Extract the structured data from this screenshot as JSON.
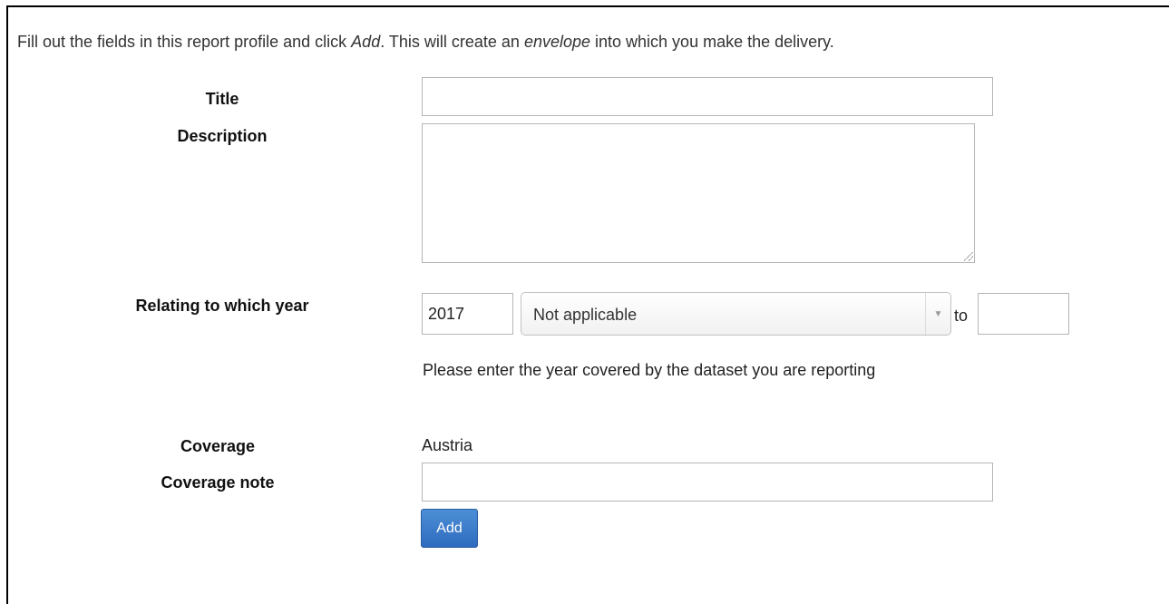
{
  "intro": {
    "part1": "Fill out the fields in this report profile and click ",
    "add_word": "Add",
    "part2": ". This will create an ",
    "envelope_word": "envelope",
    "part3": " into which you make the delivery."
  },
  "form": {
    "title_label": "Title",
    "title_value": "",
    "description_label": "Description",
    "description_value": "",
    "year_label": "Relating to which year",
    "year_value": "2017",
    "year_qualifier_selected": "Not applicable",
    "to_label": "to",
    "year_to_value": "",
    "year_help": "Please enter the year covered by the dataset you are reporting",
    "coverage_label": "Coverage",
    "coverage_value": "Austria",
    "coverage_note_label": "Coverage note",
    "coverage_note_value": "",
    "add_button": "Add"
  },
  "icons": {
    "select_arrow": "chevron-down-icon",
    "resize": "resize-grip-icon"
  },
  "colors": {
    "button_bg": "#337ab7",
    "border": "#b5b5b5"
  }
}
